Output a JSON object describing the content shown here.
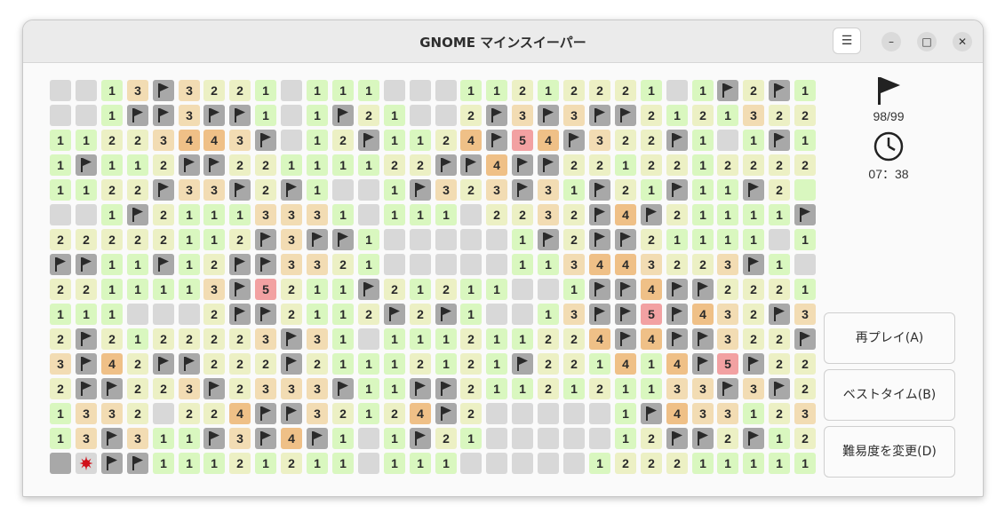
{
  "window": {
    "title": "GNOME マインスイーパー"
  },
  "titlebar": {
    "menu_icon": "hamburger-menu-icon",
    "minimize_icon": "minimize-icon",
    "maximize_icon": "maximize-icon",
    "close_icon": "close-icon"
  },
  "status": {
    "flags": "98/99",
    "time": "07：38",
    "flag_icon": "flag-icon",
    "clock_icon": "clock-icon"
  },
  "buttons": {
    "replay": "再プレイ(A)",
    "best_times": "ベストタイム(B)",
    "change_difficulty": "難易度を変更(D)"
  },
  "board": {
    "cols": 30,
    "rows": 16,
    "legend": {
      ".": "unrevealed",
      "F": "flag",
      "X": "exploded-mine",
      "U": "unflagged-mine",
      "digits": "adjacent mine count",
      "0": "empty"
    },
    "grid": [
      "..13F3221.111...11212221.1F2F1",
      "..1FF3FF1.1F21..2F3F3FF21213222",
      "11223443F.12F1124F54F322F1.1F1",
      "1F112FF22111122FF4FF22122122222",
      "1122F33F2F1..1F323F31F21F11F2",
      "..1F21113331.111.2232F4F21111F",
      "22222112F3FF1.....1F2FF21111.11",
      "FF11F12FF3321.....113443223F1.11",
      "2211113F5211F21211..1FF4FF22212F",
      "111...2FF2112F2F1..13FF5F432F32",
      "2F2122223F31.111211224F4FF322F",
      "3F42FF222F21112121F221414F5F22F",
      "2FF223F2333F11FF2112121133F3F2F",
      "1332.224FF32124F2.....1F433123F",
      "13F311F3F4F1.1F21.....12FF2F12F",
      "UXFF11121211.111.....1222111111"
    ]
  }
}
